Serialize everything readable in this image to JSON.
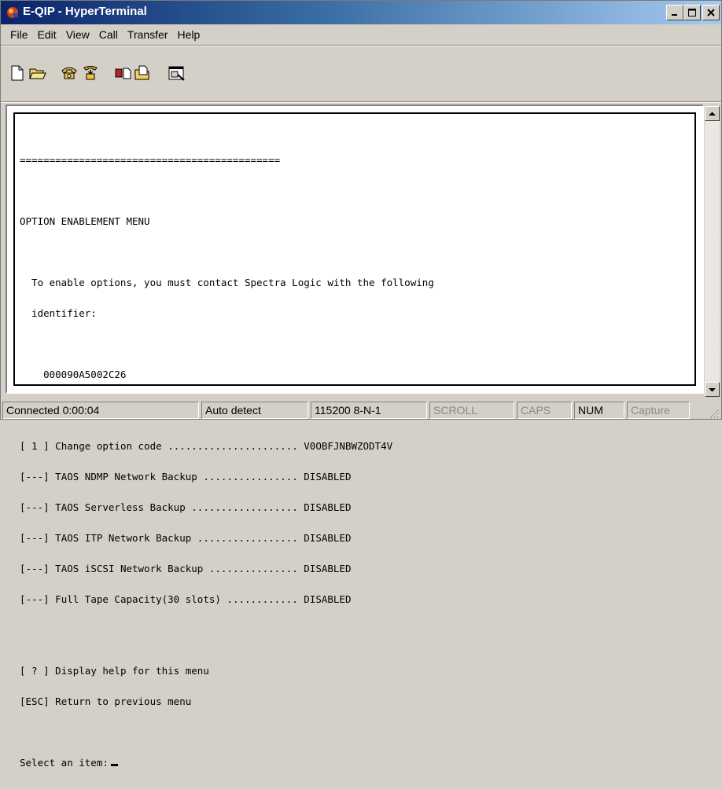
{
  "window": {
    "title": "E-QIP - HyperTerminal",
    "controls": {
      "minimize": "_",
      "maximize": "□",
      "close": "×"
    }
  },
  "menu": {
    "items": [
      "File",
      "Edit",
      "View",
      "Call",
      "Transfer",
      "Help"
    ]
  },
  "toolbar": {
    "buttons": [
      {
        "name": "new",
        "icon": "new-document-icon"
      },
      {
        "name": "open",
        "icon": "open-folder-icon"
      },
      {
        "name": "connect",
        "icon": "phone-icon"
      },
      {
        "name": "disconnect",
        "icon": "hang-up-icon"
      },
      {
        "name": "send",
        "icon": "send-file-icon"
      },
      {
        "name": "receive",
        "icon": "receive-file-icon"
      },
      {
        "name": "properties",
        "icon": "properties-icon"
      }
    ]
  },
  "terminal": {
    "divider": "============================================",
    "menu_title": "OPTION ENABLEMENT MENU",
    "intro_line1": "  To enable options, you must contact Spectra Logic with the following",
    "intro_line2": "  identifier:",
    "identifier": "    000090A5002C26",
    "options": [
      {
        "key": "[ 1 ]",
        "label": "Change option code ......................",
        "value": "V0OBFJNBWZODT4V"
      },
      {
        "key": "[---]",
        "label": "TAOS NDMP Network Backup ................",
        "value": "DISABLED"
      },
      {
        "key": "[---]",
        "label": "TAOS Serverless Backup ..................",
        "value": "DISABLED"
      },
      {
        "key": "[---]",
        "label": "TAOS ITP Network Backup .................",
        "value": "DISABLED"
      },
      {
        "key": "[---]",
        "label": "TAOS iSCSI Network Backup ...............",
        "value": "DISABLED"
      },
      {
        "key": "[---]",
        "label": "Full Tape Capacity(30 slots) ............",
        "value": "DISABLED"
      }
    ],
    "help_key": "[ ? ]",
    "help_label": "Display help for this menu",
    "esc_key": "[ESC]",
    "esc_label": "Return to previous menu",
    "prompt": "Select an item:"
  },
  "status": {
    "connection": "Connected 0:00:04",
    "detect": "Auto detect",
    "settings": "115200 8-N-1",
    "scroll": "SCROLL",
    "caps": "CAPS",
    "num": "NUM",
    "capture": "Capture"
  },
  "colors": {
    "title_start": "#0a246a",
    "title_end": "#a6caf0",
    "chrome": "#d4d0c8"
  }
}
